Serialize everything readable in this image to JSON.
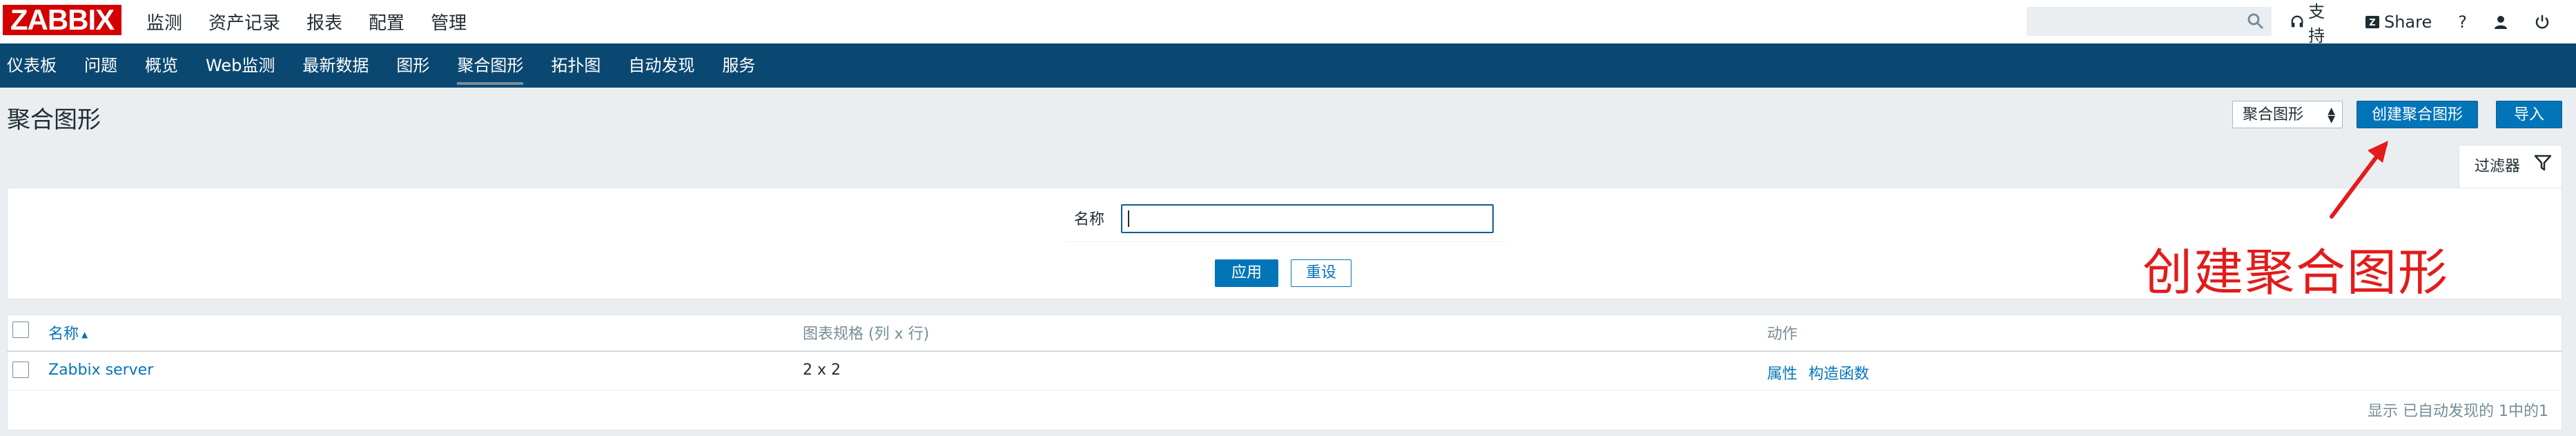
{
  "top": {
    "logo": "ZABBIX",
    "menu": [
      "监测",
      "资产记录",
      "报表",
      "配置",
      "管理"
    ],
    "search_placeholder": "",
    "support_label": "支持",
    "share_label": "Share",
    "help_label": "?",
    "icons": [
      "search-icon",
      "headset-icon",
      "share-icon",
      "user-icon",
      "power-icon"
    ]
  },
  "nav": {
    "items": [
      "仪表板",
      "问题",
      "概览",
      "Web监测",
      "最新数据",
      "图形",
      "聚合图形",
      "拓扑图",
      "自动发现",
      "服务"
    ],
    "active": "聚合图形"
  },
  "header": {
    "title": "聚合图形",
    "select_value": "聚合图形",
    "create_button": "创建聚合图形",
    "import_button": "导入"
  },
  "filter": {
    "tab_label": "过滤器",
    "name_label": "名称",
    "name_value": "",
    "apply_button": "应用",
    "reset_button": "重设"
  },
  "table": {
    "headers": [
      "名称",
      "图表规格 (列 x 行)",
      "动作"
    ],
    "rows": [
      {
        "name": "Zabbix server",
        "size": "2 x 2",
        "action_props": "属性",
        "action_constructor": "构造函数"
      }
    ],
    "footer": "显示 已自动发现的 1中的1"
  },
  "annotation": {
    "text": "创建聚合图形",
    "color": "#e31b1b"
  },
  "colors": {
    "nav_bg": "#0b4871",
    "primary": "#0275b8",
    "logo_red": "#d40000"
  }
}
